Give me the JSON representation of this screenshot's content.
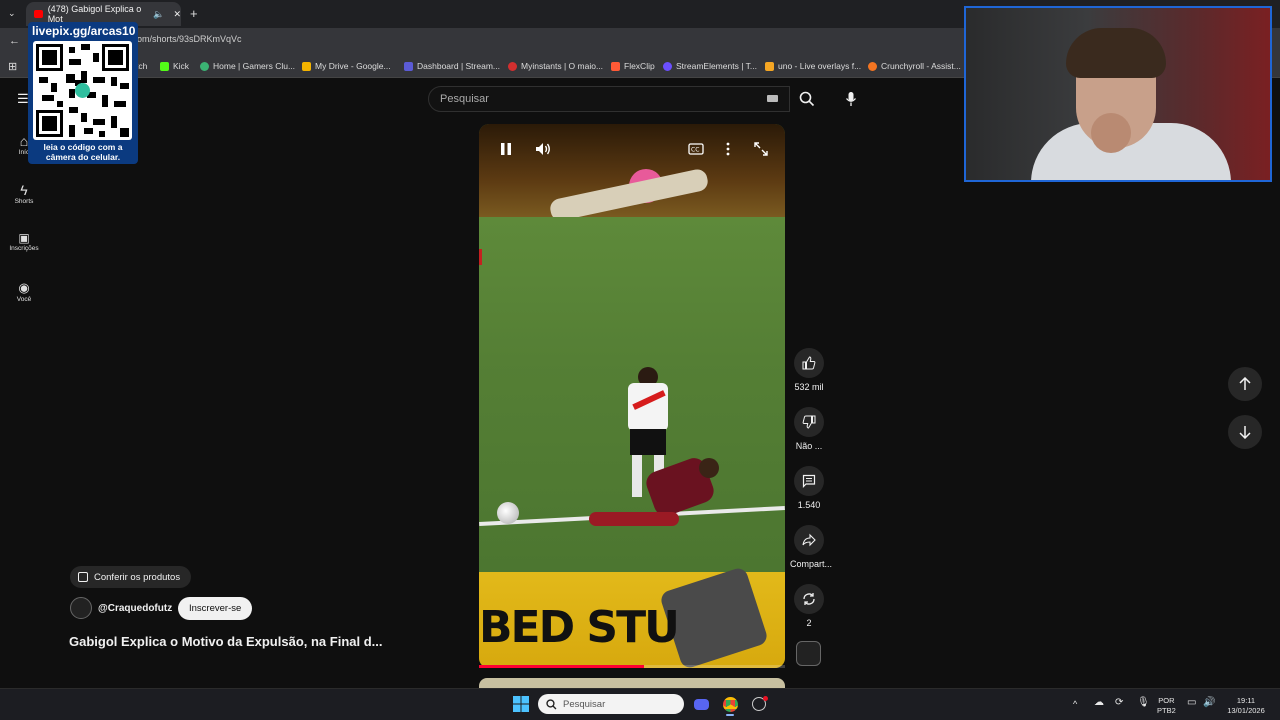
{
  "browser": {
    "tab_title": "(478) Gabigol Explica o Mot",
    "url": ".com/shorts/93sDRKmVqVc",
    "bookmarks": [
      {
        "label": "tch",
        "color": "#9146ff"
      },
      {
        "label": "Kick",
        "color": "#53fc18"
      },
      {
        "label": "Home | Gamers Clu...",
        "color": "#3bb273"
      },
      {
        "label": "My Drive - Google...",
        "color": "#f4b400"
      },
      {
        "label": "Dashboard | Stream...",
        "color": "#5b5bd6"
      },
      {
        "label": "Myinstants | O maio...",
        "color": "#d32f2f"
      },
      {
        "label": "FlexClip",
        "color": "#ff5a36"
      },
      {
        "label": "StreamElements | T...",
        "color": "#6b4fff"
      },
      {
        "label": "uno - Live overlays f...",
        "color": "#f5a623"
      },
      {
        "label": "Crunchyroll - Assist...",
        "color": "#f47521"
      }
    ]
  },
  "overlay": {
    "qr_title": "livepix.gg/arcas10",
    "qr_caption": "leia o código com a câmera do celular."
  },
  "nav": {
    "home": "Iníc",
    "shorts": "Shorts",
    "subscriptions": "Inscrições",
    "you": "Você"
  },
  "search": {
    "placeholder": "Pesquisar"
  },
  "video": {
    "bottom_text": "BED STU"
  },
  "actions": {
    "likes": "532 mil",
    "dislike": "Não ...",
    "comments": "1.540",
    "share": "Compart...",
    "remix": "2"
  },
  "channel": {
    "products": "Conferir os produtos",
    "name": "@Craquedofutz",
    "subscribe": "Inscrever-se",
    "title": "Gabigol Explica o Motivo da Expulsão, na Final d..."
  },
  "taskbar": {
    "search": "Pesquisar",
    "lang": "POR",
    "layout": "PTB2",
    "time": "19:11",
    "date": "13/01/2026"
  }
}
